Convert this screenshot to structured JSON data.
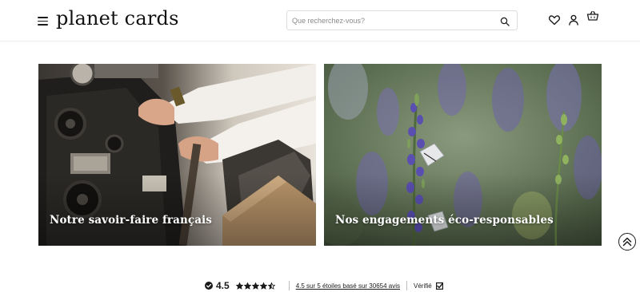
{
  "header": {
    "brand": "planet cards",
    "search_placeholder": "Que recherchez-vous?"
  },
  "icons": {
    "menu": "hamburger-menu-icon",
    "search": "search-icon",
    "wishlist": "heart-icon",
    "account": "user-icon",
    "cart": "basket-icon",
    "scroll_top": "double-chevron-up-icon"
  },
  "cards": [
    {
      "title": "Notre savoir-faire français",
      "image": "letterpress-printing-photo"
    },
    {
      "title": "Nos engagements éco-responsables",
      "image": "wildflowers-butterfly-photo"
    }
  ],
  "reviews": {
    "score": "4.5",
    "rating_out_of_5": 4.5,
    "summary": "4.5 sur 5 étoiles basé sur 30654 avis",
    "verified_label": "Vérifié"
  },
  "colors": {
    "text": "#1a1a1a",
    "border": "#ececec",
    "card_text": "#ffffff"
  }
}
